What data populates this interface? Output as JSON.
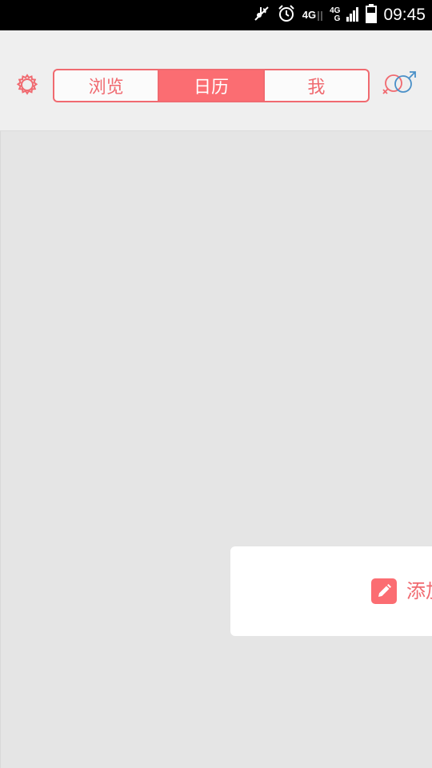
{
  "status_bar": {
    "time": "09:45",
    "network_1": "4G",
    "network_2_top": "4G",
    "network_2_bottom": "G",
    "icons": [
      "mute-icon",
      "alarm-icon",
      "signal-icon",
      "signal-icon",
      "battery-icon"
    ]
  },
  "header": {
    "settings_icon": "gear-icon",
    "gender_icon": "female-male-icon",
    "tabs": [
      {
        "label": "浏览",
        "active": false
      },
      {
        "label": "日历",
        "active": true
      },
      {
        "label": "我",
        "active": false
      }
    ]
  },
  "main": {
    "add_card": {
      "icon": "pencil-icon",
      "label": "添加"
    }
  },
  "colors": {
    "accent": "#fb6d72",
    "accent_text": "#f06a70",
    "male_blue": "#4a90c8",
    "background": "#e5e5e5",
    "header_bg": "#efefef"
  }
}
